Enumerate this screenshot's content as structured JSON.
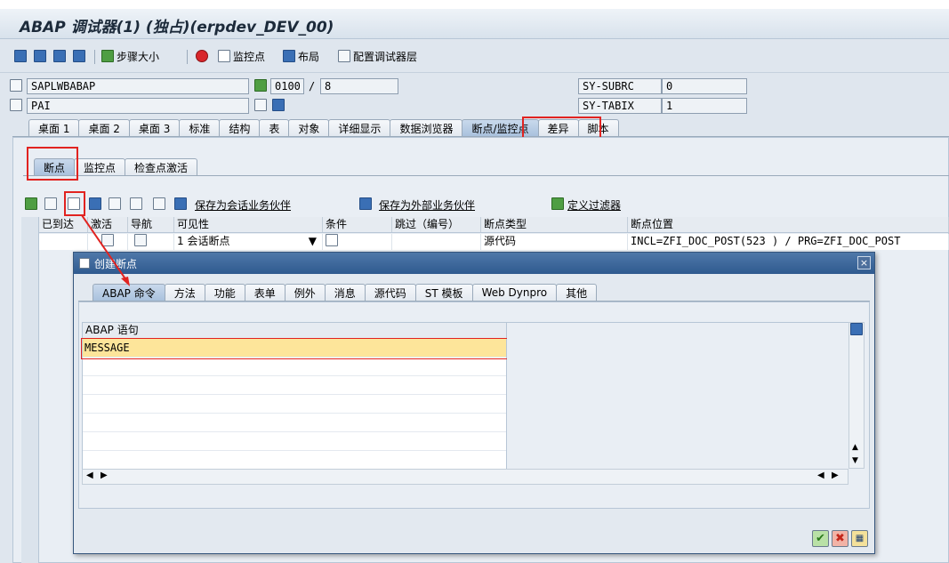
{
  "window": {
    "title": "ABAP 调试器(1) (独占)(erpdev_DEV_00)"
  },
  "toolbar": {
    "step_size": "步骤大小",
    "watchpoint": "监控点",
    "layout": "布局",
    "configure_layers": "配置调试器层"
  },
  "header_fields": {
    "program": "SAPLWBABAP",
    "event": "PAI",
    "screen": "0100",
    "slash": "/",
    "screen_line": "8",
    "sy_subrc_label": "SY-SUBRC",
    "sy_subrc_value": "0",
    "sy_tabix_label": "SY-TABIX",
    "sy_tabix_value": "1"
  },
  "main_tabs": [
    {
      "label": "桌面 1"
    },
    {
      "label": "桌面 2"
    },
    {
      "label": "桌面 3"
    },
    {
      "label": "标准"
    },
    {
      "label": "结构"
    },
    {
      "label": "表"
    },
    {
      "label": "对象"
    },
    {
      "label": "详细显示"
    },
    {
      "label": "数据浏览器"
    },
    {
      "label": "断点/监控点",
      "active": true
    },
    {
      "label": "差异"
    },
    {
      "label": "脚本"
    }
  ],
  "sub_tabs": [
    {
      "label": "断点",
      "active": true
    },
    {
      "label": "监控点"
    },
    {
      "label": "检查点激活"
    }
  ],
  "bp_toolbar": {
    "save_session_partner": "保存为会话业务伙伴",
    "save_external_partner": "保存为外部业务伙伴",
    "define_filter": "定义过滤器"
  },
  "bp_grid": {
    "columns": [
      "已到达",
      "激活",
      "导航",
      "可见性",
      "条件",
      "跳过（编号）",
      "断点类型",
      "断点位置"
    ],
    "rows": [
      {
        "visibility": "1 会话断点",
        "type": "源代码",
        "location": "INCL=ZFI_DOC_POST(523 ) / PRG=ZFI_DOC_POST"
      }
    ]
  },
  "dialog": {
    "title": "创建断点",
    "close": "×",
    "tabs": [
      {
        "label": "ABAP 命令",
        "active": true
      },
      {
        "label": "方法"
      },
      {
        "label": "功能"
      },
      {
        "label": "表单"
      },
      {
        "label": "例外"
      },
      {
        "label": "消息"
      },
      {
        "label": "源代码"
      },
      {
        "label": "ST 模板"
      },
      {
        "label": "Web Dynpro"
      },
      {
        "label": "其他"
      }
    ],
    "table_header": "ABAP 语句",
    "table_rows": [
      "MESSAGE",
      "",
      "",
      "",
      "",
      "",
      ""
    ]
  },
  "colors": {
    "accent_red": "#e12320",
    "title_blue": "#2f5a8f",
    "highlight_row": "#fde59a"
  }
}
